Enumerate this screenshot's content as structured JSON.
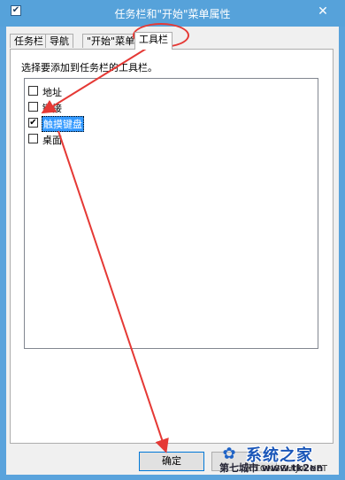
{
  "window": {
    "title": "任务栏和\"开始\"菜单属性",
    "close_glyph": "✕",
    "icon_glyph": "✔"
  },
  "tabs": [
    {
      "label": "任务栏",
      "active": false
    },
    {
      "label": "导航",
      "active": false
    },
    {
      "label": "\"开始\"菜单",
      "active": false
    },
    {
      "label": "工具栏",
      "active": true
    }
  ],
  "toolbars_tab": {
    "instruction": "选择要添加到任务栏的工具栏。",
    "items": [
      {
        "label": "地址",
        "checked": false,
        "selected": false
      },
      {
        "label": "链接",
        "checked": false,
        "selected": false
      },
      {
        "label": "触摸键盘",
        "checked": true,
        "selected": true
      },
      {
        "label": "桌面",
        "checked": false,
        "selected": false
      }
    ]
  },
  "buttons": {
    "ok": "确定",
    "cancel": ""
  },
  "annotation": {
    "highlight_color": "#e53935"
  },
  "watermark": {
    "logo_glyph": "✿",
    "brand": "系统之家",
    "url": "XITONGZHIJIA.NET",
    "overlay_text": "第七城市 www.tk2en"
  }
}
